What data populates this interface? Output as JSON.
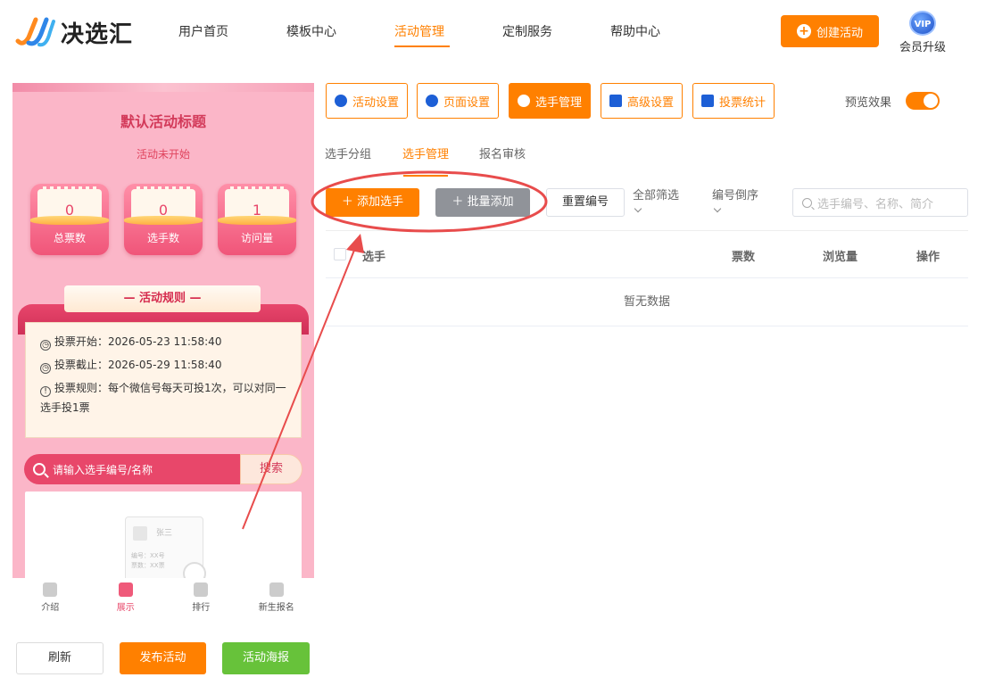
{
  "brand": {
    "name": "决选汇"
  },
  "nav": {
    "items": [
      {
        "label": "用户首页",
        "active": false
      },
      {
        "label": "模板中心",
        "active": false
      },
      {
        "label": "活动管理",
        "active": true
      },
      {
        "label": "定制服务",
        "active": false
      },
      {
        "label": "帮助中心",
        "active": false
      }
    ],
    "create_label": "创建活动",
    "vip_badge": "VIP",
    "vip_label": "会员升级"
  },
  "preview": {
    "title": "默认活动标题",
    "status": "活动未开始",
    "stats": [
      {
        "value": "0",
        "label": "总票数"
      },
      {
        "value": "0",
        "label": "选手数"
      },
      {
        "value": "1",
        "label": "访问量"
      }
    ],
    "rules_title": "— 活动规则 —",
    "rules": [
      {
        "icon": "clock-icon",
        "text": "投票开始：2026-05-23 11:58:40"
      },
      {
        "icon": "clock-icon",
        "text": "投票截止：2026-05-29 11:58:40"
      },
      {
        "icon": "info-icon",
        "text": "投票规则：每个微信号每天可投1次，可以对同一选手投1票"
      }
    ],
    "search_placeholder": "请输入选手编号/名称",
    "search_button": "搜索",
    "empty_illustration": {
      "name": "张三",
      "lines": [
        "编号：XX号",
        "票数：XX票"
      ]
    },
    "tabs": [
      {
        "label": "介绍",
        "icon": "person-icon",
        "active": false
      },
      {
        "label": "展示",
        "icon": "gift-icon",
        "active": true
      },
      {
        "label": "排行",
        "icon": "heart-icon",
        "active": false
      },
      {
        "label": "新生报名",
        "icon": "tag-icon",
        "active": false
      }
    ]
  },
  "bottom_actions": {
    "refresh": "刷新",
    "publish": "发布活动",
    "poster": "活动海报"
  },
  "toolbar": {
    "buttons": [
      {
        "label": "活动设置",
        "icon": "star-icon",
        "active": false
      },
      {
        "label": "页面设置",
        "icon": "gear-icon",
        "active": false
      },
      {
        "label": "选手管理",
        "icon": "users-icon",
        "active": true
      },
      {
        "label": "高级设置",
        "icon": "sliders-icon",
        "active": false
      },
      {
        "label": "投票统计",
        "icon": "bar-chart-icon",
        "active": false
      }
    ],
    "preview_label": "预览效果",
    "preview_on": true
  },
  "subtabs": [
    {
      "label": "选手分组",
      "active": false
    },
    {
      "label": "选手管理",
      "active": true
    },
    {
      "label": "报名审核",
      "active": false
    }
  ],
  "actions": {
    "add": "添加选手",
    "batch": "批量添加",
    "reset": "重置编号",
    "filter_all": "全部筛选",
    "sort": "编号倒序",
    "search_placeholder": "选手编号、名称、简介"
  },
  "table": {
    "columns": [
      "选手",
      "票数",
      "浏览量",
      "操作"
    ],
    "empty_text": "暂无数据"
  },
  "colors": {
    "accent": "#ff8000",
    "annotation": "#e84c4c",
    "preview_pink": "#fbb6c8",
    "grey_button": "#909399",
    "green_button": "#67c23a"
  }
}
